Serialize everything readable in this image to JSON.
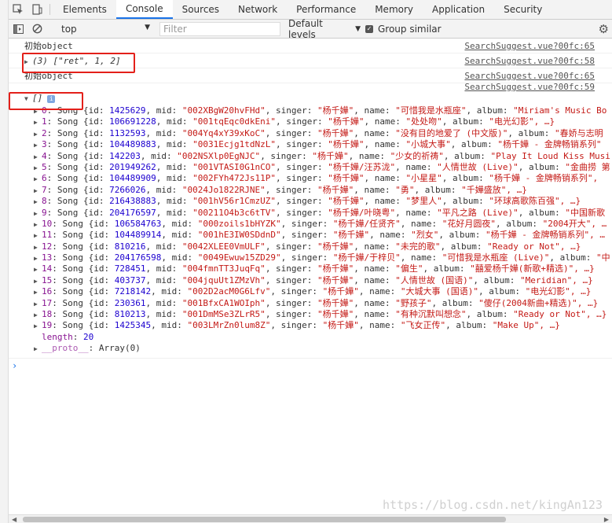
{
  "tabs": [
    "Elements",
    "Console",
    "Sources",
    "Network",
    "Performance",
    "Memory",
    "Application",
    "Security"
  ],
  "toolbar": {
    "context": "top",
    "filter_placeholder": "Filter",
    "levels": "Default levels",
    "group_similar": "Group similar"
  },
  "messages": [
    {
      "text": "初始object",
      "source": "SearchSuggest.vue?00fc:65"
    },
    {
      "text": "(3) [\"ret\", 1, 2]",
      "source": "SearchSuggest.vue?00fc:58"
    },
    {
      "text": "初始object",
      "source": "SearchSuggest.vue?00fc:65"
    },
    {
      "text": "",
      "source": "SearchSuggest.vue?00fc:59"
    }
  ],
  "array_head": "[]",
  "info_glyph": "i",
  "songs": [
    {
      "i": "0",
      "id": "1425629",
      "mid": "\"002XBgW20hvFHd\"",
      "singer": "\"杨千嬅\"",
      "name": "\"可惜我是水瓶座\"",
      "album": "\"Miriam's Music Bo"
    },
    {
      "i": "1",
      "id": "106691228",
      "mid": "\"001tqEqc0dkEni\"",
      "singer": "\"杨千嬅\"",
      "name": "\"处处吻\"",
      "album": "\"电光幻影\", …}"
    },
    {
      "i": "2",
      "id": "1132593",
      "mid": "\"004Yq4xY39xKoC\"",
      "singer": "\"杨千嬅\"",
      "name": "\"没有目的地爱了 (中文版)\"",
      "album": "\"春娇与志明"
    },
    {
      "i": "3",
      "id": "104489883",
      "mid": "\"0031Ecjg1tdNzL\"",
      "singer": "\"杨千嬅\"",
      "name": "\"小城大事\"",
      "album": "\"杨千嬅 - 金牌畅销系列\""
    },
    {
      "i": "4",
      "id": "142203",
      "mid": "\"002NSXlp0EgNJC\"",
      "singer": "\"杨千嬅\"",
      "name": "\"少女的祈祷\"",
      "album": "\"Play It Loud Kiss Musi"
    },
    {
      "i": "5",
      "id": "201949262",
      "mid": "\"001VTASI0G1nCO\"",
      "singer": "\"杨千嬅/汪苏泷\"",
      "name": "\"人情世故 (Live)\"",
      "album": "\"金曲捞 第"
    },
    {
      "i": "6",
      "id": "104489909",
      "mid": "\"002FYh472Js11P\"",
      "singer": "\"杨千嬅\"",
      "name": "\"小星星\"",
      "album": "\"杨千嬅 - 金牌畅销系列\","
    },
    {
      "i": "7",
      "id": "7266026",
      "mid": "\"0024Jo1822RJNE\"",
      "singer": "\"杨千嬅\"",
      "name": "\"勇\"",
      "album": "\"千嬅盛放\", …}"
    },
    {
      "i": "8",
      "id": "216438883",
      "mid": "\"001hV56r1CmzUZ\"",
      "singer": "\"杨千嬅\"",
      "name": "\"梦里人\"",
      "album": "\"环球高歌陈百强\", …}"
    },
    {
      "i": "9",
      "id": "204176597",
      "mid": "\"00211O4b3c6tTV\"",
      "singer": "\"杨千嬅/叶晓粤\"",
      "name": "\"平凡之路 (Live)\"",
      "album": "\"中国新歌"
    },
    {
      "i": "10",
      "id": "106584763",
      "mid": "\"000zoils1bHYZK\"",
      "singer": "\"杨千嬅/任贤齐\"",
      "name": "\"花好月圆夜\"",
      "album": "\"2004开大\", …"
    },
    {
      "i": "11",
      "id": "104489914",
      "mid": "\"001hE3IW0SDdnD\"",
      "singer": "\"杨千嬅\"",
      "name": "\"烈女\"",
      "album": "\"杨千嬅 - 金牌畅销系列\", …"
    },
    {
      "i": "12",
      "id": "810216",
      "mid": "\"0042XLEE0VmULF\"",
      "singer": "\"杨千嬅\"",
      "name": "\"未完的歌\"",
      "album": "\"Ready or Not\", …}"
    },
    {
      "i": "13",
      "id": "204176598",
      "mid": "\"0049Ewuw15ZD29\"",
      "singer": "\"杨千嬅/于梓贝\"",
      "name": "\"可惜我是水瓶座 (Live)\"",
      "album": "\"中"
    },
    {
      "i": "14",
      "id": "728451",
      "mid": "\"004fmnTT3JuqFq\"",
      "singer": "\"杨千嬅\"",
      "name": "\"偏生\"",
      "album": "\"囍爱杨千嬅(新歌+精选)\", …}"
    },
    {
      "i": "15",
      "id": "403737",
      "mid": "\"004jquUt1ZMzVh\"",
      "singer": "\"杨千嬅\"",
      "name": "\"人情世故 (国语)\"",
      "album": "\"Meridian\", …}"
    },
    {
      "i": "16",
      "id": "7218142",
      "mid": "\"002D2acM0G6Lfv\"",
      "singer": "\"杨千嬅\"",
      "name": "\"大城大事 (国语)\"",
      "album": "\"电光幻影\", …}"
    },
    {
      "i": "17",
      "id": "230361",
      "mid": "\"001BfxCA1WOIph\"",
      "singer": "\"杨千嬅\"",
      "name": "\"野孩子\"",
      "album": "\"傻仔(2004新曲+精选)\", …}"
    },
    {
      "i": "18",
      "id": "810213",
      "mid": "\"001DmMSe3ZLrR5\"",
      "singer": "\"杨千嬅\"",
      "name": "\"有种沉默叫想念\"",
      "album": "\"Ready or Not\", …}"
    },
    {
      "i": "19",
      "id": "1425345",
      "mid": "\"003LMrZn0lum8Z\"",
      "singer": "\"杨千嬅\"",
      "name": "\"飞女正传\"",
      "album": "\"Make Up\", …}"
    }
  ],
  "length_label": "length",
  "length_value": "20",
  "proto_label": "__proto__",
  "proto_value": "Array(0)",
  "watermark": "https://blog.csdn.net/kingAn123"
}
